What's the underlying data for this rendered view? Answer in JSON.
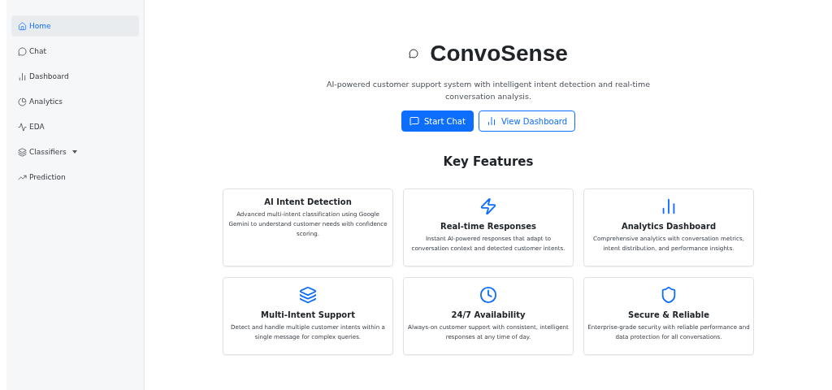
{
  "sidebar": {
    "items": [
      {
        "label": "Home",
        "selected": true
      },
      {
        "label": "Chat",
        "selected": false
      },
      {
        "label": "Dashboard",
        "selected": false
      },
      {
        "label": "Analytics",
        "selected": false
      },
      {
        "label": "EDA",
        "selected": false
      },
      {
        "label": "Classifiers",
        "selected": false,
        "dropdown": true
      },
      {
        "label": "Prediction",
        "selected": false
      }
    ]
  },
  "hero": {
    "title": "ConvoSense",
    "subtitle": "AI-powered customer support system with intelligent intent detection and real-time conversation analysis.",
    "buttons": [
      {
        "label": "Start Chat",
        "kind": "primary"
      },
      {
        "label": "View Dashboard",
        "kind": "outline"
      }
    ]
  },
  "features": {
    "heading": "Key Features",
    "cards": [
      {
        "title": "AI Intent Detection",
        "text": "Advanced multi-intent classification using Google Gemini to understand customer needs with confidence scoring."
      },
      {
        "title": "Real-time Responses",
        "text": "Instant AI-powered responses that adapt to conversation context and detected customer intents."
      },
      {
        "title": "Analytics Dashboard",
        "text": "Comprehensive analytics with conversation metrics, intent distribution, and performance insights."
      },
      {
        "title": "Multi-Intent Support",
        "text": "Detect and handle multiple customer intents within a single message for complex queries."
      },
      {
        "title": "24/7 Availability",
        "text": "Always-on customer support with consistent, intelligent responses at any time of day."
      },
      {
        "title": "Secure & Reliable",
        "text": "Enterprise-grade security with reliable performance and data protection for all conversations."
      }
    ]
  }
}
